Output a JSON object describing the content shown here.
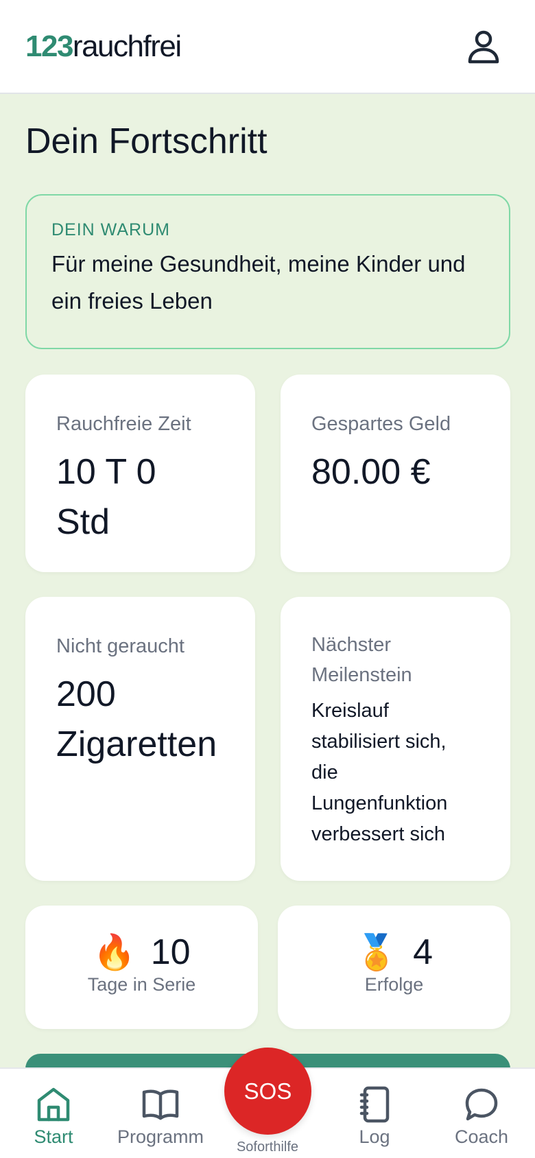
{
  "header": {
    "logo_number": "123",
    "logo_text": "rauchfrei",
    "profile_icon": "user-icon"
  },
  "page_title": "Dein Fortschritt",
  "why": {
    "label": "DEIN WARUM",
    "text": "Für meine Gesundheit, meine Kinder und ein freies Leben"
  },
  "stats": {
    "smoke_free_time": {
      "label": "Rauchfreie Zeit",
      "value": "10 T 0 Std"
    },
    "money_saved": {
      "label": "Gespartes Geld",
      "value": "80.00 €"
    },
    "not_smoked": {
      "label": "Nicht geraucht",
      "value": "200 Zigaretten"
    },
    "next_milestone": {
      "label": "Nächster Meilenstein",
      "text": "Kreislauf stabilisiert sich, die Lungenfunktion verbessert sich"
    }
  },
  "streak": {
    "emoji": "🔥",
    "value": "10",
    "label": "Tage in Serie"
  },
  "achievements": {
    "emoji": "🏅",
    "value": "4",
    "label": "Erfolge"
  },
  "nav": {
    "start": "Start",
    "programm": "Programm",
    "sos": "SOS",
    "sos_label": "Soforthilfe",
    "log": "Log",
    "coach": "Coach"
  },
  "colors": {
    "accent": "#2f8b72",
    "background": "#eaf3e1",
    "sos": "#dc2626",
    "why_border": "#7fd8a6"
  }
}
